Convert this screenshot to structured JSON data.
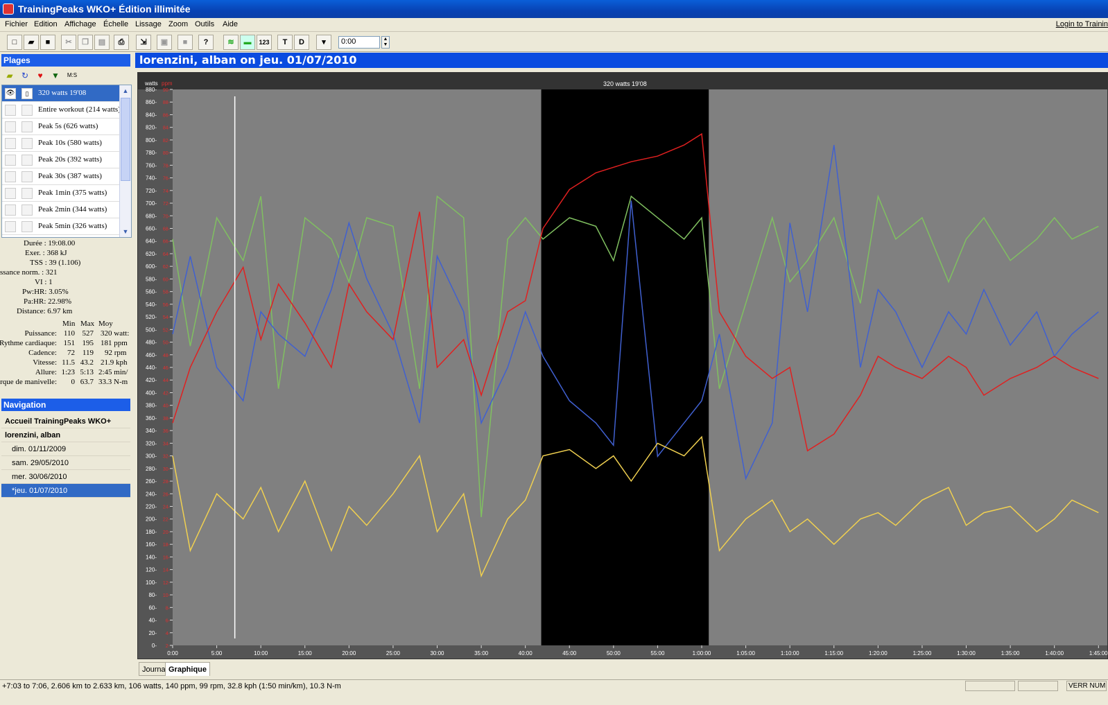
{
  "window": {
    "title": "TrainingPeaks WKO+ Édition illimitée"
  },
  "menu": {
    "items": [
      "Fichier",
      "Edition",
      "Affichage",
      "Échelle",
      "Lissage",
      "Zoom",
      "Outils",
      "Aide"
    ],
    "login": "Login to Trainin"
  },
  "toolbar": {
    "time": "0:00",
    "t_label": "T",
    "d_label": "D",
    "num_label": "123"
  },
  "plages": {
    "header": "Plages",
    "tools": [
      "folder-icon",
      "refresh-icon",
      "heart-icon",
      "shield-icon"
    ],
    "tool_ms": "M:S",
    "ranges": [
      "320 watts 19'08",
      "Entire workout (214 watts)",
      "Peak 5s (626 watts)",
      "Peak 10s (580 watts)",
      "Peak 20s (392 watts)",
      "Peak 30s (387 watts)",
      "Peak 1min (375 watts)",
      "Peak 2min (344 watts)",
      "Peak 5min (326 watts)"
    ]
  },
  "stats": {
    "summary": [
      "Durée : 19:08.00",
      "Exer. : 368 kJ",
      "TSS : 39 (1.106)",
      "ssance norm. : 321",
      "VI : 1",
      "Pw:HR: 3.05%",
      "Pa:HR: 22.98%",
      "Distance: 6.97 km"
    ],
    "columns": [
      "Min",
      "Max",
      "Moy"
    ],
    "rows": [
      [
        "Puissance:",
        "110",
        "527",
        "320 watt:"
      ],
      [
        "Rythme cardiaque:",
        "151",
        "195",
        "181 ppm"
      ],
      [
        "Cadence:",
        "72",
        "119",
        "92 rpm"
      ],
      [
        "Vitesse:",
        "11.5",
        "43.2",
        "21.9 kph"
      ],
      [
        "Allure:",
        "1:23",
        "5:13",
        "2:45 min/"
      ],
      [
        "rque de manivelle:",
        "0",
        "63.7",
        "33.3 N-m"
      ]
    ]
  },
  "navigation": {
    "header": "Navigation",
    "items": [
      "Accueil TrainingPeaks WKO+",
      "lorenzini, alban",
      "dim. 01/11/2009",
      "sam. 29/05/2010",
      "mer. 30/06/2010",
      "*jeu. 01/07/2010"
    ]
  },
  "main": {
    "title": "lorenzini, alban on jeu. 01/07/2010"
  },
  "tabs": [
    "Journal",
    "Graphique"
  ],
  "status": {
    "text": "+7:03 to 7:06, 2.606 km to 2.633 km, 106 watts, 140 ppm, 99 rpm, 32.8 kph (1:50 min/km), 10.3 N-m",
    "num": "VERR NUM"
  },
  "colors": {
    "power": "#f0d050",
    "heart_rate": "#e02020",
    "cadence": "#80c060",
    "speed": "#4060d0",
    "selection_bg": "#000000",
    "plot_bg": "#808080"
  },
  "chart_data": {
    "type": "line",
    "selection_label": "320 watts 19'08",
    "y_units": [
      "watts",
      "ppm"
    ],
    "ylim": [
      0,
      880
    ],
    "yticks": [
      0,
      20,
      40,
      60,
      80,
      100,
      120,
      140,
      160,
      180,
      200,
      220,
      240,
      260,
      280,
      300,
      320,
      340,
      360,
      380,
      400,
      420,
      440,
      460,
      480,
      500,
      520,
      540,
      560,
      580,
      600,
      620,
      640,
      660,
      680,
      700,
      720,
      740,
      760,
      780,
      800,
      820,
      840,
      860,
      880
    ],
    "hr_ticks": [
      "2",
      "4",
      "6",
      "8",
      "10",
      "12",
      "14",
      "16",
      "18",
      "20",
      "22",
      "24",
      "26",
      "28",
      "30",
      "32",
      "34",
      "36",
      "38",
      "40",
      "42",
      "44",
      "46",
      "48",
      "50",
      "52",
      "54",
      "56",
      "58",
      "60",
      "62",
      "64",
      "66",
      "68",
      "70",
      "72",
      "74",
      "76",
      "78",
      "80",
      "82",
      "84",
      "86",
      "88",
      "90"
    ],
    "x_ticks": [
      "0:00",
      "5:00",
      "10:00",
      "15:00",
      "20:00",
      "25:00",
      "30:00",
      "35:00",
      "40:00",
      "45:00",
      "50:00",
      "55:00",
      "1:00:00",
      "1:05:00",
      "1:10:00",
      "1:15:00",
      "1:20:00",
      "1:25:00",
      "1:30:00",
      "1:35:00",
      "1:40:00",
      "1:45:00"
    ],
    "x_range_min": [
      0,
      106
    ],
    "selection_min": [
      41.8,
      60.8
    ],
    "cursor_min": 7.05,
    "series": [
      {
        "name": "power",
        "x_min": [
          0,
          2,
          5,
          8,
          10,
          12,
          15,
          18,
          20,
          22,
          25,
          28,
          30,
          33,
          35,
          38,
          40,
          42,
          45,
          48,
          50,
          52,
          55,
          58,
          60,
          62,
          65,
          68,
          70,
          72,
          75,
          78,
          80,
          82,
          85,
          88,
          90,
          92,
          95,
          98,
          100,
          102,
          105
        ],
        "values": [
          300,
          150,
          240,
          200,
          250,
          180,
          260,
          150,
          220,
          190,
          240,
          300,
          180,
          240,
          110,
          200,
          230,
          300,
          310,
          280,
          300,
          260,
          320,
          300,
          330,
          150,
          200,
          230,
          180,
          200,
          160,
          200,
          210,
          190,
          230,
          250,
          190,
          210,
          220,
          180,
          200,
          230,
          210
        ]
      },
      {
        "name": "heart_rate",
        "x_min": [
          0,
          2,
          5,
          8,
          10,
          12,
          15,
          18,
          20,
          22,
          25,
          28,
          30,
          33,
          35,
          38,
          40,
          42,
          45,
          48,
          50,
          52,
          55,
          58,
          60,
          62,
          65,
          68,
          70,
          72,
          75,
          78,
          80,
          82,
          85,
          88,
          90,
          92,
          95,
          98,
          100,
          102,
          105
        ],
        "values": [
          140,
          150,
          160,
          168,
          155,
          165,
          158,
          150,
          165,
          160,
          155,
          178,
          150,
          155,
          145,
          160,
          162,
          175,
          182,
          185,
          186,
          187,
          188,
          190,
          192,
          160,
          152,
          148,
          150,
          135,
          138,
          145,
          152,
          150,
          148,
          152,
          150,
          145,
          148,
          150,
          152,
          150,
          148
        ]
      },
      {
        "name": "cadence",
        "x_min": [
          0,
          2,
          5,
          8,
          10,
          12,
          15,
          18,
          20,
          22,
          25,
          28,
          30,
          33,
          35,
          38,
          40,
          42,
          45,
          48,
          50,
          52,
          55,
          58,
          60,
          62,
          65,
          68,
          70,
          72,
          75,
          78,
          80,
          82,
          85,
          88,
          90,
          92,
          95,
          98,
          100,
          102,
          105
        ],
        "values": [
          95,
          70,
          100,
          90,
          105,
          60,
          100,
          95,
          85,
          100,
          98,
          60,
          105,
          100,
          30,
          95,
          100,
          95,
          100,
          98,
          90,
          105,
          100,
          95,
          100,
          60,
          80,
          100,
          85,
          90,
          100,
          80,
          105,
          95,
          100,
          85,
          95,
          100,
          90,
          95,
          100,
          95,
          98
        ]
      },
      {
        "name": "speed",
        "x_min": [
          0,
          2,
          5,
          8,
          10,
          12,
          15,
          18,
          20,
          22,
          25,
          28,
          30,
          33,
          35,
          38,
          40,
          42,
          45,
          48,
          50,
          52,
          55,
          58,
          60,
          62,
          65,
          68,
          70,
          72,
          75,
          78,
          80,
          82,
          85,
          88,
          90,
          92,
          95,
          98,
          100,
          102,
          105
        ],
        "values": [
          28,
          35,
          25,
          22,
          30,
          28,
          26,
          32,
          38,
          33,
          28,
          20,
          35,
          30,
          20,
          25,
          30,
          26,
          22,
          20,
          18,
          40,
          17,
          20,
          22,
          28,
          15,
          20,
          38,
          30,
          45,
          25,
          32,
          30,
          25,
          30,
          28,
          32,
          27,
          30,
          26,
          28,
          30
        ]
      }
    ]
  }
}
